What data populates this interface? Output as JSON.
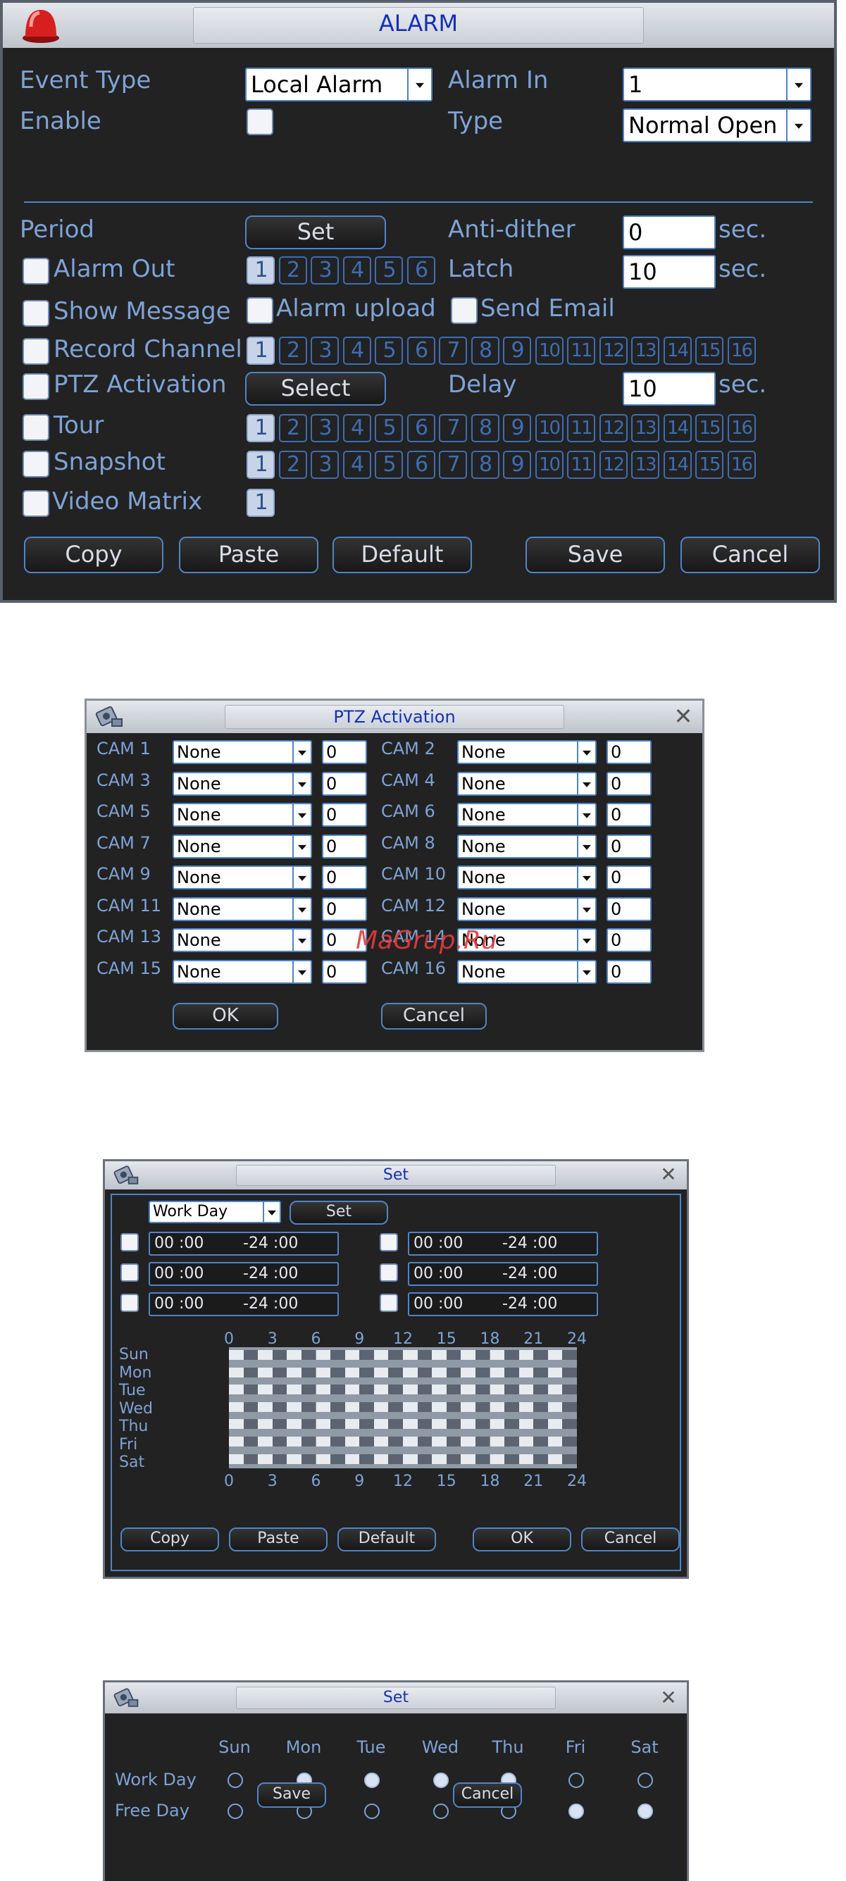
{
  "alarm": {
    "title": "ALARM",
    "event_type": {
      "label": "Event Type",
      "value": "Local Alarm"
    },
    "alarm_in": {
      "label": "Alarm In",
      "value": "1"
    },
    "enable": {
      "label": "Enable"
    },
    "type": {
      "label": "Type",
      "value": "Normal Open"
    },
    "period": {
      "label": "Period",
      "button": "Set"
    },
    "anti_dither": {
      "label": "Anti-dither",
      "value": "0",
      "unit": "sec."
    },
    "alarm_out": {
      "label": "Alarm Out",
      "channels": [
        "1",
        "2",
        "3",
        "4",
        "5",
        "6"
      ]
    },
    "latch": {
      "label": "Latch",
      "value": "10",
      "unit": "sec."
    },
    "show_message": {
      "label": "Show Message"
    },
    "alarm_upload": {
      "label": "Alarm upload"
    },
    "send_email": {
      "label": "Send Email"
    },
    "record_channel": {
      "label": "Record Channel"
    },
    "ptz_activation": {
      "label": "PTZ Activation",
      "button": "Select"
    },
    "delay": {
      "label": "Delay",
      "value": "10",
      "unit": "sec."
    },
    "tour": {
      "label": "Tour"
    },
    "snapshot": {
      "label": "Snapshot"
    },
    "video_matrix": {
      "label": "Video Matrix",
      "channels": [
        "1"
      ]
    },
    "channels16": [
      "1",
      "2",
      "3",
      "4",
      "5",
      "6",
      "7",
      "8",
      "9",
      "10",
      "11",
      "12",
      "13",
      "14",
      "15",
      "16"
    ],
    "buttons": {
      "copy": "Copy",
      "paste": "Paste",
      "default": "Default",
      "save": "Save",
      "cancel": "Cancel"
    }
  },
  "ptz": {
    "title": "PTZ Activation",
    "cams": [
      {
        "label": "CAM 1",
        "value": "None",
        "num": "0"
      },
      {
        "label": "CAM 2",
        "value": "None",
        "num": "0"
      },
      {
        "label": "CAM 3",
        "value": "None",
        "num": "0"
      },
      {
        "label": "CAM 4",
        "value": "None",
        "num": "0"
      },
      {
        "label": "CAM 5",
        "value": "None",
        "num": "0"
      },
      {
        "label": "CAM 6",
        "value": "None",
        "num": "0"
      },
      {
        "label": "CAM 7",
        "value": "None",
        "num": "0"
      },
      {
        "label": "CAM 8",
        "value": "None",
        "num": "0"
      },
      {
        "label": "CAM 9",
        "value": "None",
        "num": "0"
      },
      {
        "label": "CAM 10",
        "value": "None",
        "num": "0"
      },
      {
        "label": "CAM 11",
        "value": "None",
        "num": "0"
      },
      {
        "label": "CAM 12",
        "value": "None",
        "num": "0"
      },
      {
        "label": "CAM 13",
        "value": "None",
        "num": "0"
      },
      {
        "label": "CAM 14",
        "value": "None",
        "num": "0"
      },
      {
        "label": "CAM 15",
        "value": "None",
        "num": "0"
      },
      {
        "label": "CAM 16",
        "value": "None",
        "num": "0"
      }
    ],
    "watermark": "MaGrup.Ru",
    "ok": "OK",
    "cancel": "Cancel"
  },
  "set1": {
    "title": "Set",
    "day_select": "Work Day",
    "set_button": "Set",
    "time_start": "00 :00",
    "time_end": "-24 :00",
    "days": [
      "Sun",
      "Mon",
      "Tue",
      "Wed",
      "Thu",
      "Fri",
      "Sat"
    ],
    "hours": [
      "0",
      "3",
      "6",
      "9",
      "12",
      "15",
      "18",
      "21",
      "24"
    ],
    "buttons": {
      "copy": "Copy",
      "paste": "Paste",
      "default": "Default",
      "ok": "OK",
      "cancel": "Cancel"
    }
  },
  "set2": {
    "title": "Set",
    "days": [
      "Sun",
      "Mon",
      "Tue",
      "Wed",
      "Thu",
      "Fri",
      "Sat"
    ],
    "rows": [
      {
        "label": "Work Day",
        "selected": [
          false,
          true,
          true,
          true,
          true,
          false,
          false
        ]
      },
      {
        "label": "Free Day",
        "selected": [
          false,
          false,
          false,
          false,
          false,
          true,
          true
        ]
      }
    ],
    "save": "Save",
    "cancel": "Cancel"
  },
  "colors": {
    "panel": "#222222",
    "accent": "#4f84c8",
    "label": "#7ea3d6",
    "title": "#1530b8"
  }
}
